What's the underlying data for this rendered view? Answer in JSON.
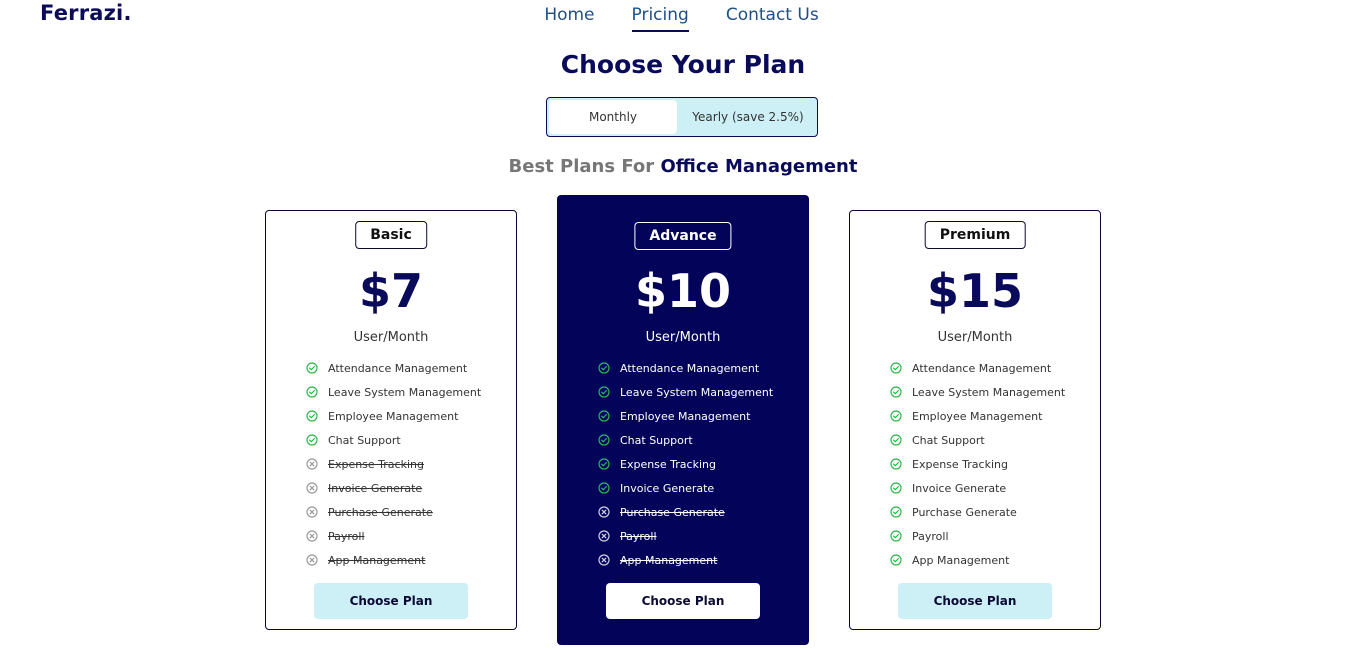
{
  "brand": "Ferrazi.",
  "nav": {
    "home": "Home",
    "pricing": "Pricing",
    "contact": "Contact Us"
  },
  "heading": "Choose Your Plan",
  "billing": {
    "monthly": "Monthly",
    "yearly": "Yearly (save 2.5%)",
    "selected": "Monthly"
  },
  "subheading": {
    "prefix": "Best Plans For",
    "highlight": "Office Management"
  },
  "colors": {
    "navy": "#03035a",
    "accent_light": "#cdeff6",
    "check_green": "#2db84a",
    "cross_grey": "#9a9a9a"
  },
  "plans": [
    {
      "name": "Basic",
      "price": "$7",
      "unit": "User/Month",
      "button": "Choose Plan",
      "features": [
        {
          "label": "Attendance Management",
          "included": true
        },
        {
          "label": "Leave System Management",
          "included": true
        },
        {
          "label": "Employee Management",
          "included": true
        },
        {
          "label": "Chat Support",
          "included": true
        },
        {
          "label": "Expense Tracking",
          "included": false
        },
        {
          "label": "Invoice Generate",
          "included": false
        },
        {
          "label": "Purchase Generate",
          "included": false
        },
        {
          "label": "Payroll",
          "included": false
        },
        {
          "label": "App Management",
          "included": false
        }
      ]
    },
    {
      "name": "Advance",
      "price": "$10",
      "unit": "User/Month",
      "button": "Choose Plan",
      "features": [
        {
          "label": "Attendance Management",
          "included": true
        },
        {
          "label": "Leave System Management",
          "included": true
        },
        {
          "label": "Employee Management",
          "included": true
        },
        {
          "label": "Chat Support",
          "included": true
        },
        {
          "label": "Expense Tracking",
          "included": true
        },
        {
          "label": "Invoice Generate",
          "included": true
        },
        {
          "label": "Purchase Generate",
          "included": false
        },
        {
          "label": "Payroll",
          "included": false
        },
        {
          "label": "App Management",
          "included": false
        }
      ]
    },
    {
      "name": "Premium",
      "price": "$15",
      "unit": "User/Month",
      "button": "Choose Plan",
      "features": [
        {
          "label": "Attendance Management",
          "included": true
        },
        {
          "label": "Leave System Management",
          "included": true
        },
        {
          "label": "Employee Management",
          "included": true
        },
        {
          "label": "Chat Support",
          "included": true
        },
        {
          "label": "Expense Tracking",
          "included": true
        },
        {
          "label": "Invoice Generate",
          "included": true
        },
        {
          "label": "Purchase Generate",
          "included": true
        },
        {
          "label": "Payroll",
          "included": true
        },
        {
          "label": "App Management",
          "included": true
        }
      ]
    }
  ]
}
